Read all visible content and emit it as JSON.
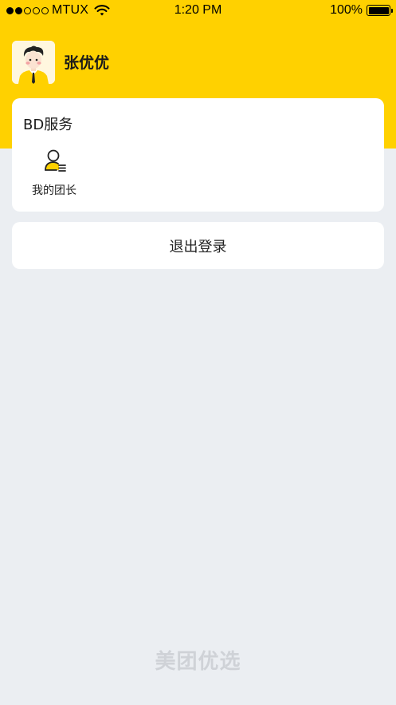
{
  "status_bar": {
    "carrier": "MTUX",
    "time": "1:20 PM",
    "battery": "100%",
    "signal_icon": "signal-dots-icon",
    "wifi_icon": "wifi-icon",
    "battery_icon": "battery-icon"
  },
  "profile": {
    "name": "张优优",
    "avatar_icon": "user-avatar-icon"
  },
  "bd_services": {
    "title": "BD服务",
    "items": [
      {
        "label": "我的团长",
        "icon": "team-leader-icon"
      }
    ]
  },
  "logout": {
    "label": "退出登录"
  },
  "footer": {
    "brand": "美团优选"
  },
  "colors": {
    "header_yellow": "#ffd100",
    "page_background": "#ebeef2",
    "card_background": "#ffffff",
    "brand_footer_text": "#cfd2d7"
  }
}
